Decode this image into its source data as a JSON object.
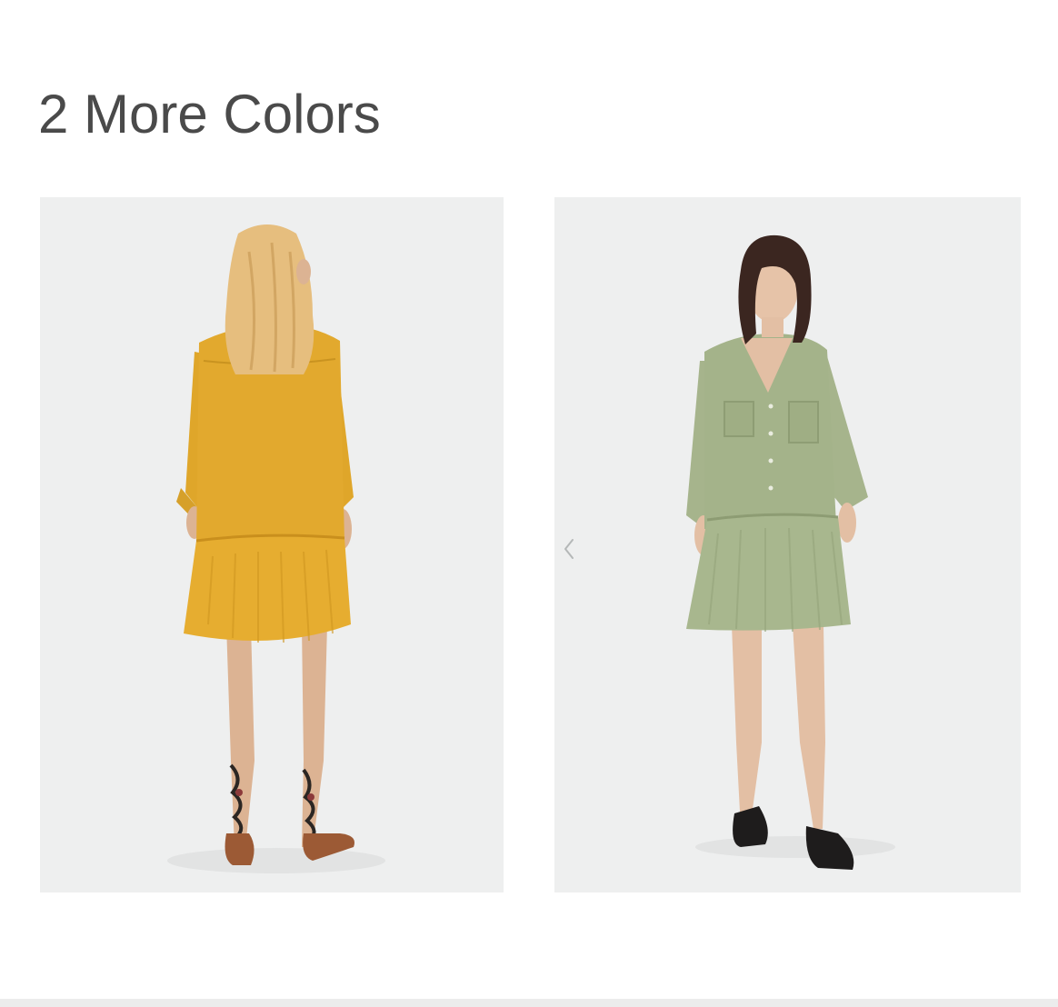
{
  "section": {
    "heading": "2 More Colors"
  },
  "products": [
    {
      "color_name": "mustard",
      "swatch": "#e2a92e",
      "view": "back"
    },
    {
      "color_name": "khaki",
      "swatch": "#a4b38a",
      "view": "front"
    }
  ],
  "carousel": {
    "prev_icon": "chevron-left-icon"
  },
  "colors": {
    "heading_text": "#4a4a4a",
    "photo_background": "#eeefef",
    "footer_bar": "#ececec"
  }
}
